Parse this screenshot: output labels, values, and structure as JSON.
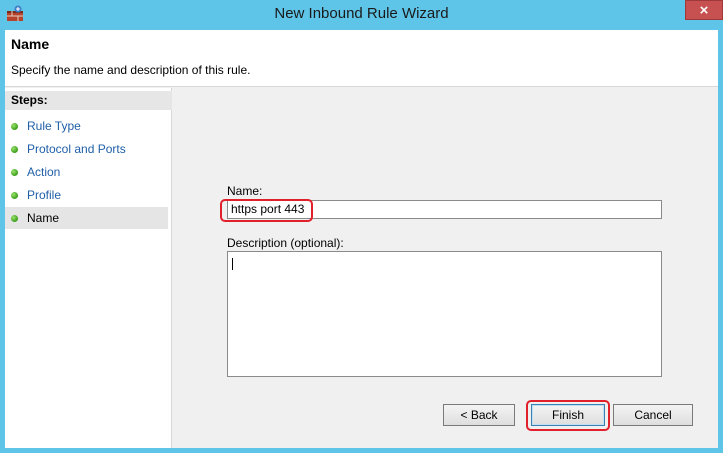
{
  "window": {
    "title": "New Inbound Rule Wizard",
    "close_label": "×",
    "icon": "firewall-wizard-icon"
  },
  "header": {
    "title": "Name",
    "description": "Specify the name and description of this rule."
  },
  "steps": {
    "heading": "Steps:",
    "items": [
      {
        "label": "Rule Type",
        "active": false
      },
      {
        "label": "Protocol and Ports",
        "active": false
      },
      {
        "label": "Action",
        "active": false
      },
      {
        "label": "Profile",
        "active": false
      },
      {
        "label": "Name",
        "active": true
      }
    ]
  },
  "form": {
    "name_label": "Name:",
    "name_value": "https port 443",
    "description_label": "Description (optional):",
    "description_value": ""
  },
  "buttons": {
    "back": "< Back",
    "finish": "Finish",
    "cancel": "Cancel"
  },
  "colors": {
    "frame": "#5ec5e8",
    "step_link": "#1f5fa8",
    "highlight": "#e0202b",
    "step_dot": "#3a9e1a"
  }
}
